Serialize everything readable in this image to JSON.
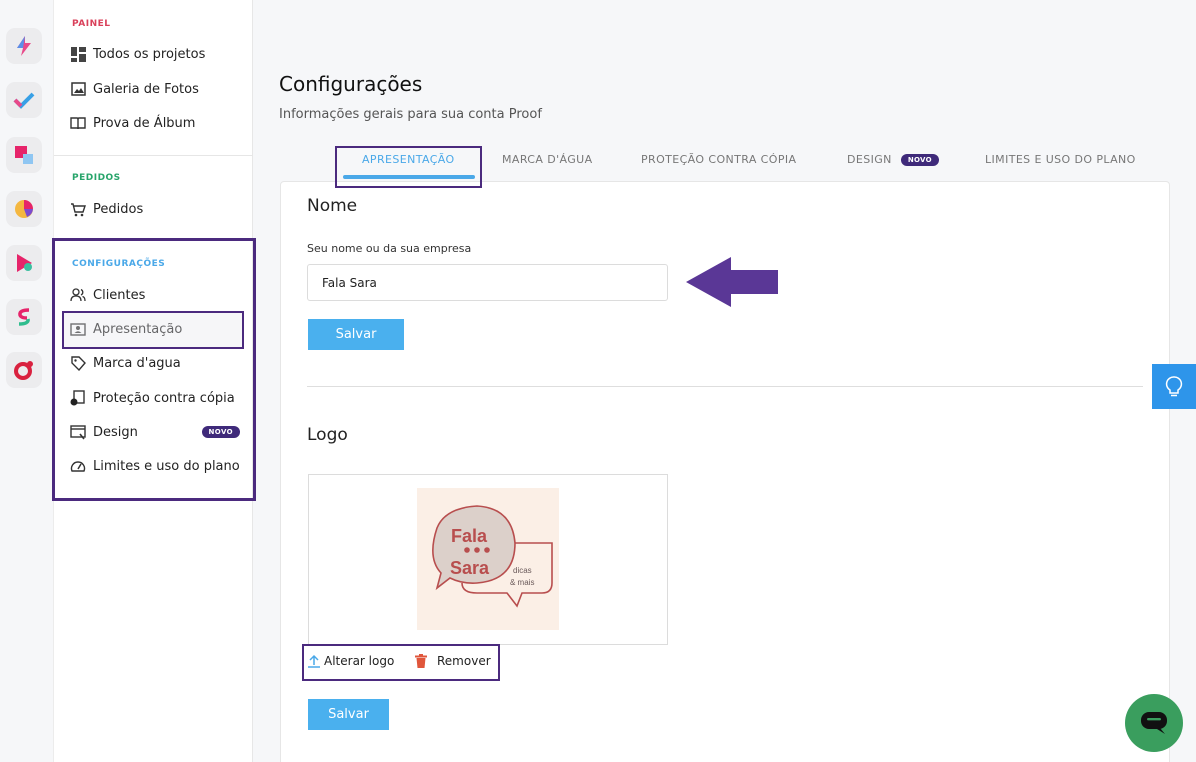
{
  "sidebar": {
    "painel_title": "PAINEL",
    "painel_items": [
      {
        "label": "Todos os projetos",
        "icon": "grid-icon"
      },
      {
        "label": "Galeria de Fotos",
        "icon": "photo-icon"
      },
      {
        "label": "Prova de Álbum",
        "icon": "book-icon"
      }
    ],
    "pedidos_title": "PEDIDOS",
    "pedidos_items": [
      {
        "label": "Pedidos",
        "icon": "cart-icon"
      }
    ],
    "config_title": "CONFIGURAÇÕES",
    "config_items": [
      {
        "label": "Clientes",
        "icon": "users-icon"
      },
      {
        "label": "Apresentação",
        "icon": "id-card-icon"
      },
      {
        "label": "Marca d'agua",
        "icon": "tag-icon"
      },
      {
        "label": "Proteção contra cópia",
        "icon": "copy-lock-icon"
      },
      {
        "label": "Design",
        "icon": "design-icon",
        "badge": "NOVO"
      },
      {
        "label": "Limites e uso do plano",
        "icon": "gauge-icon"
      }
    ]
  },
  "page": {
    "title": "Configurações",
    "subtitle": "Informações gerais para sua conta Proof"
  },
  "tabs": [
    {
      "label": "APRESENTAÇÃO",
      "active": true
    },
    {
      "label": "MARCA D'ÁGUA"
    },
    {
      "label": "PROTEÇÃO CONTRA CÓPIA"
    },
    {
      "label": "DESIGN",
      "badge": "NOVO"
    },
    {
      "label": "LIMITES E USO DO PLANO"
    }
  ],
  "name_section": {
    "heading": "Nome",
    "field_label": "Seu nome ou da sua empresa",
    "field_value": "Fala Sara",
    "save_label": "Salvar"
  },
  "logo_section": {
    "heading": "Logo",
    "logo_text_line1": "Fala",
    "logo_text_line2": "Sara",
    "logo_small_line1": "dicas",
    "logo_small_line2": "& mais",
    "change_label": "Alterar logo",
    "remove_label": "Remover",
    "save_label": "Salvar"
  },
  "colors": {
    "accent": "#4aa8e8",
    "button": "#4ab0ee",
    "highlight": "#4b2a7e",
    "badge": "#3f2a7a",
    "chat": "#3a9e5e"
  }
}
